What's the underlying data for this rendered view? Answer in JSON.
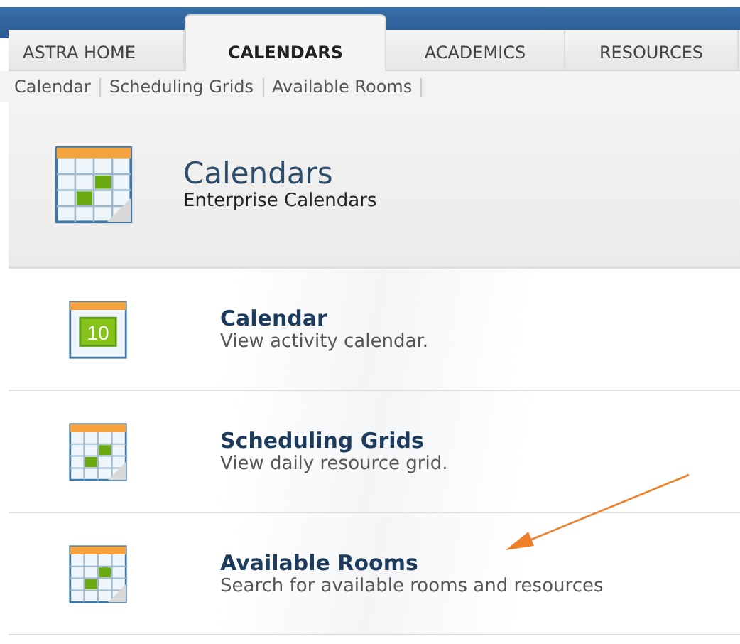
{
  "tabs": [
    {
      "label": "ASTRA HOME",
      "selected": false
    },
    {
      "label": "CALENDARS",
      "selected": true
    },
    {
      "label": "ACADEMICS",
      "selected": false
    },
    {
      "label": "RESOURCES",
      "selected": false
    }
  ],
  "subnav": [
    "Calendar",
    "Scheduling Grids",
    "Available Rooms"
  ],
  "header": {
    "title": "Calendars",
    "subtitle": "Enterprise Calendars"
  },
  "items": [
    {
      "kind": "day",
      "day": "10",
      "title": "Calendar",
      "description": "View activity calendar."
    },
    {
      "kind": "grid",
      "title": "Scheduling Grids",
      "description": "View daily resource grid."
    },
    {
      "kind": "grid",
      "title": "Available Rooms",
      "description": "Search for available rooms and resources"
    }
  ],
  "annotation": {
    "kind": "arrow"
  }
}
